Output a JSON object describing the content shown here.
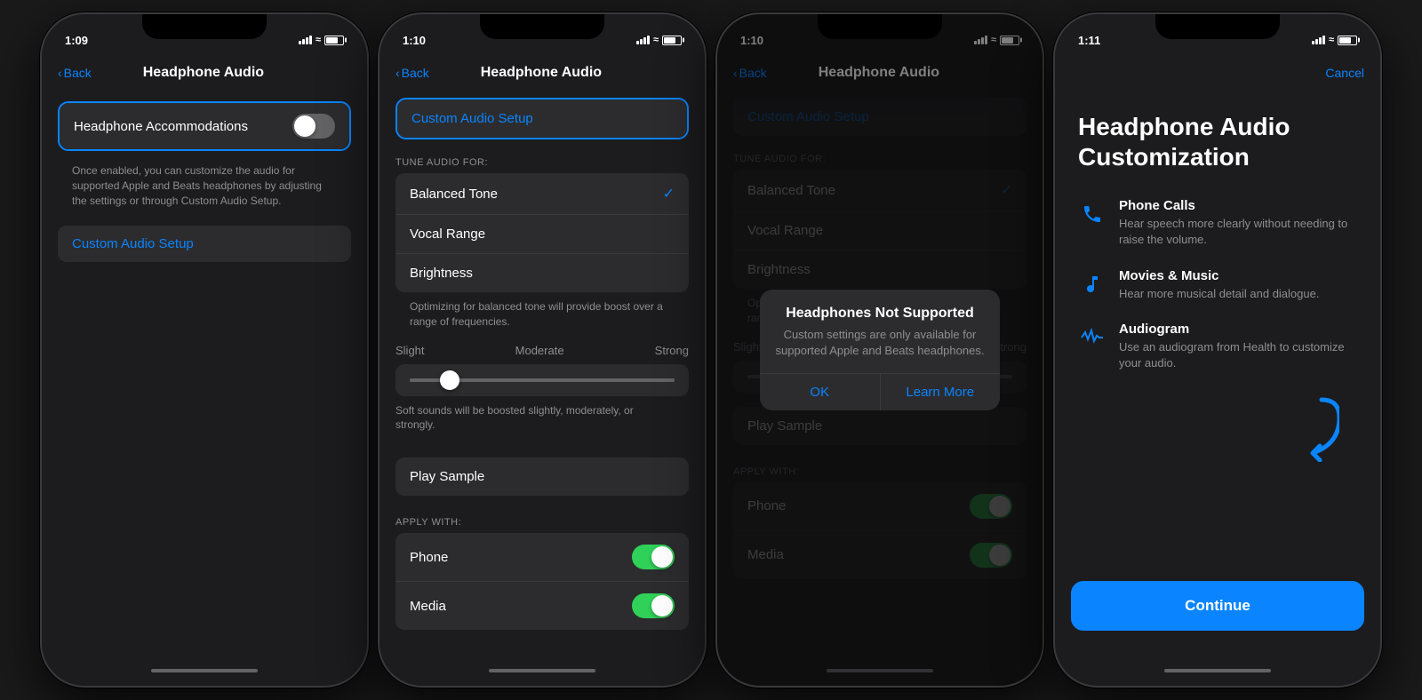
{
  "phone1": {
    "statusBar": {
      "time": "1:09",
      "signal": "●●●",
      "wifi": "wifi",
      "battery": "battery"
    },
    "navBack": "Back",
    "navTitle": "Headphone Audio",
    "accommodations": {
      "label": "Headphone Accommodations",
      "toggleState": "off",
      "description": "Once enabled, you can customize the audio for supported Apple and Beats headphones by adjusting the settings or through Custom Audio Setup."
    },
    "customAudioSetup": "Custom Audio Setup"
  },
  "phone2": {
    "statusBar": {
      "time": "1:10"
    },
    "navBack": "Back",
    "navTitle": "Headphone Audio",
    "customAudioSetup": "Custom Audio Setup",
    "tuneAudioFor": "TUNE AUDIO FOR:",
    "tuneOptions": [
      "Balanced Tone",
      "Vocal Range",
      "Brightness"
    ],
    "selectedTune": "Balanced Tone",
    "tuneDescription": "Optimizing for balanced tone will provide boost over a range of frequencies.",
    "sliderLabels": {
      "left": "Slight",
      "center": "Moderate",
      "right": "Strong"
    },
    "sliderDescription": "Soft sounds will be boosted slightly, moderately, or strongly.",
    "playSample": "Play Sample",
    "applyWith": "APPLY WITH:",
    "applyItems": [
      {
        "label": "Phone",
        "on": true
      },
      {
        "label": "Media",
        "on": true
      }
    ]
  },
  "phone3": {
    "statusBar": {
      "time": "1:10"
    },
    "navBack": "Back",
    "navTitle": "Headphone Audio",
    "customAudioSetup": "Custom Audio Setup",
    "tuneAudioFor": "TUNE AUDIO FOR:",
    "tuneOptions": [
      "Balanced Tone",
      "Vocal Range",
      "Brightness"
    ],
    "selectedTune": "Balanced Tone",
    "tuneDescription": "Optimiz",
    "sliderLabels": {
      "left": "Slig",
      "center": "",
      "right": "rong"
    },
    "playSample": "Play Sample",
    "applyWith": "APPLY WITH:",
    "applyItems": [
      {
        "label": "Phone",
        "on": true
      },
      {
        "label": "Media",
        "on": true
      }
    ],
    "dialog": {
      "title": "Headphones Not Supported",
      "message": "Custom settings are only available for supported Apple and Beats headphones.",
      "okLabel": "OK",
      "learnMoreLabel": "Learn More"
    }
  },
  "phone4": {
    "statusBar": {
      "time": "1:11"
    },
    "navAction": "Cancel",
    "title": "Headphone Audio Customization",
    "features": [
      {
        "iconType": "phone",
        "title": "Phone Calls",
        "description": "Hear speech more clearly without needing to raise the volume."
      },
      {
        "iconType": "music",
        "title": "Movies & Music",
        "description": "Hear more musical detail and dialogue."
      },
      {
        "iconType": "audiogram",
        "title": "Audiogram",
        "description": "Use an audiogram from Health to customize your audio."
      }
    ],
    "continueLabel": "Continue"
  }
}
